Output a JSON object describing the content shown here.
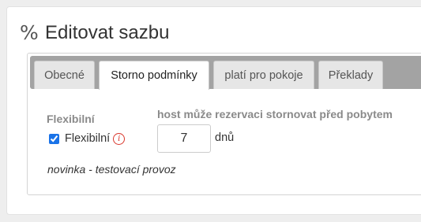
{
  "header": {
    "icon": "percent-icon",
    "icon_glyph": "%",
    "title": "Editovat sazbu"
  },
  "tabs": [
    {
      "label": "Obecné",
      "active": false
    },
    {
      "label": "Storno podmínky",
      "active": true
    },
    {
      "label": "platí pro pokoje",
      "active": false
    },
    {
      "label": "Překlady",
      "active": false
    }
  ],
  "storno": {
    "flexible_heading": "Flexibilní",
    "cancel_heading": "host může rezervaci stornovat před pobytem",
    "flexible_checkbox_label": "Flexibilní",
    "flexible_checked": true,
    "info_icon": "info-icon",
    "days_value": "7",
    "days_unit": "dnů",
    "note": "novinka - testovací provoz"
  },
  "colors": {
    "tab_strip": "#a3a3a3",
    "info_icon": "#d9362b",
    "checkbox": "#1a73e8"
  }
}
